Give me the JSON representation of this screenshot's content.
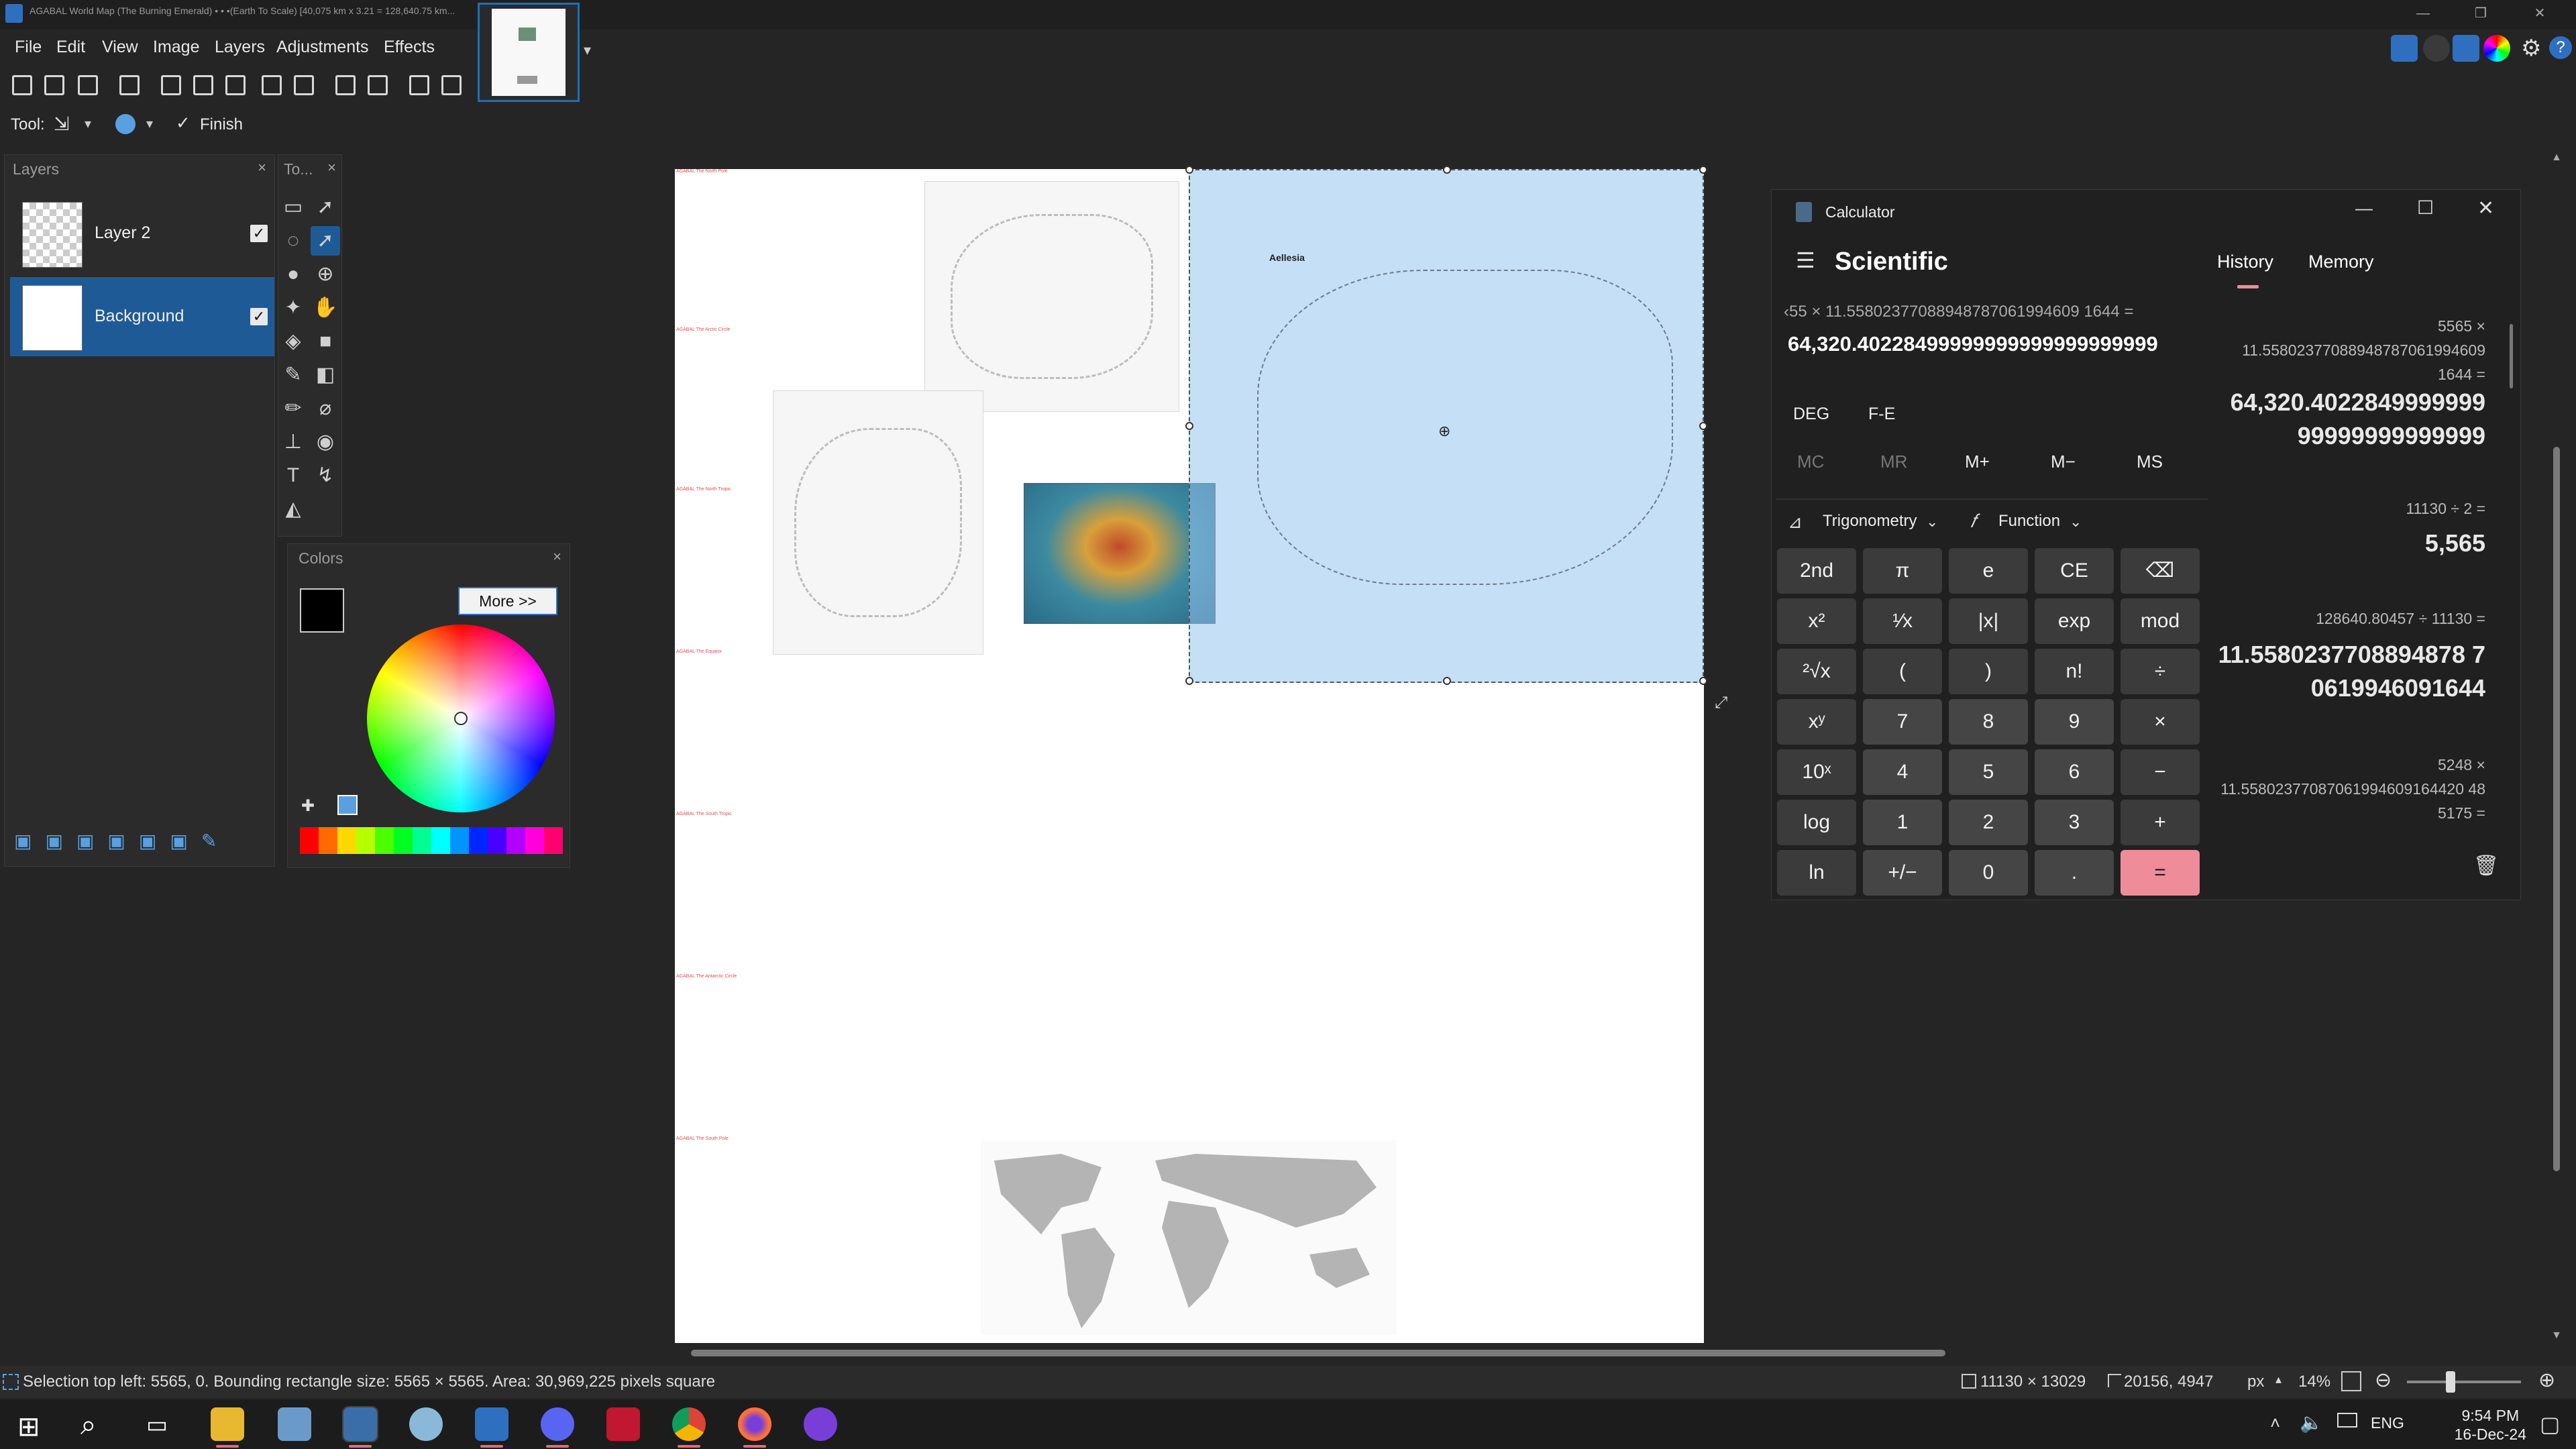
{
  "window": {
    "title": "AGABAL World Map (The Burning Emerald) • • •(Earth To Scale) [40,075 km x 3.21 = 128,640.75 km...",
    "minimize": "—",
    "restore": "❐",
    "close": "✕"
  },
  "menu": [
    "File",
    "Edit",
    "View",
    "Image",
    "Layers",
    "Adjustments",
    "Effects"
  ],
  "toolrow": {
    "tool_label": "Tool:",
    "finish": "Finish"
  },
  "layers_panel": {
    "title": "Layers",
    "items": [
      {
        "name": "Layer 2",
        "visible": true
      },
      {
        "name": "Background",
        "visible": true,
        "selected": true
      }
    ]
  },
  "tools_panel": {
    "title": "To..."
  },
  "colors_panel": {
    "title": "Colors",
    "more_button": "More >>",
    "primary": "#000000",
    "secondary": "#ffffff"
  },
  "palette": [
    "#ff0000",
    "#ff6a00",
    "#ffd800",
    "#b6ff00",
    "#4cff00",
    "#00ff21",
    "#00ff90",
    "#00ffff",
    "#0094ff",
    "#0026ff",
    "#4800ff",
    "#b200ff",
    "#ff00dc",
    "#ff006e"
  ],
  "canvas": {
    "map_title": "Aellesia",
    "labels": [
      "AGABAL The North Pole",
      "AGABAL The Arctic Circle",
      "AGABAL The North Tropic",
      "AGABAL The Equator",
      "AGABAL The South Tropic",
      "AGABAL The Antarctic Circle",
      "AGABAL The South Pole"
    ]
  },
  "calculator": {
    "title": "Calculator",
    "mode": "Scientific",
    "tabs": [
      "History",
      "Memory"
    ],
    "expression": "‹55 × 11.55802377088948787061994609 1644 =",
    "display": "64,320.40228499999999999999999999",
    "angle": "DEG",
    "fe": "F-E",
    "memory_buttons": [
      "MC",
      "MR",
      "M+",
      "M−",
      "MS"
    ],
    "dropdowns": [
      "Trigonometry",
      "Function"
    ],
    "keys": [
      [
        "2nd",
        "π",
        "e",
        "CE",
        "⌫"
      ],
      [
        "x²",
        "¹⁄x",
        "|x|",
        "exp",
        "mod"
      ],
      [
        "²√x",
        "(",
        ")",
        "n!",
        "÷"
      ],
      [
        "xʸ",
        "7",
        "8",
        "9",
        "×"
      ],
      [
        "10ˣ",
        "4",
        "5",
        "6",
        "−"
      ],
      [
        "log",
        "1",
        "2",
        "3",
        "+"
      ],
      [
        "ln",
        "+/−",
        "0",
        ".",
        "="
      ]
    ],
    "history": [
      {
        "expr1": "5565   ×",
        "expr2": "11.55802377088948787061994609",
        "expr3": "1644 =",
        "result1": "64,320.4022849999999",
        "result2": "99999999999999"
      },
      {
        "expr1": "11130   ÷   2 =",
        "result1": "5,565"
      },
      {
        "expr1": "128640.80457   ÷   11130 =",
        "result1": "11.5580237708894878 7",
        "result2": "0619946091644"
      },
      {
        "expr1": "5248   ×",
        "expr2": "11.55802377087061994609164420 48",
        "expr3": "5175 ="
      }
    ]
  },
  "status": {
    "selection_info": "Selection top left: 5565, 0. Bounding rectangle size: 5565 × 5565. Area: 30,969,225 pixels square",
    "image_size": "11130 × 13029",
    "cursor": "20156, 4947",
    "unit": "px",
    "zoom": "14%"
  },
  "taskbar": {
    "lang": "ENG",
    "time": "9:54 PM",
    "date": "16-Dec-24"
  }
}
